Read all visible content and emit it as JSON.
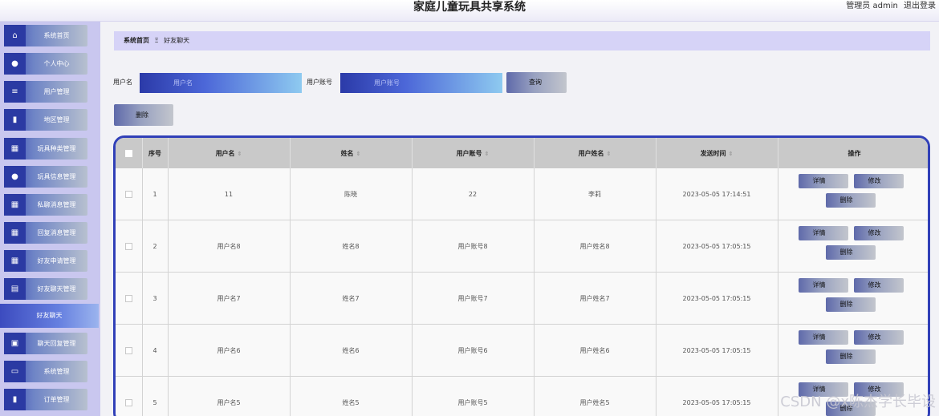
{
  "header": {
    "title": "家庭儿童玩具共享系统",
    "role": "管理员 admin",
    "logout": "退出登录"
  },
  "sidebar": {
    "items": [
      {
        "label": "系统首页",
        "icon": "home-icon",
        "glyph": "⌂"
      },
      {
        "label": "个人中心",
        "icon": "user-icon",
        "glyph": "●"
      },
      {
        "label": "用户管理",
        "icon": "list-icon",
        "glyph": "≡"
      },
      {
        "label": "地区管理",
        "icon": "bar-chart-icon",
        "glyph": "▮"
      },
      {
        "label": "玩具种类管理",
        "icon": "grid-icon",
        "glyph": "▦"
      },
      {
        "label": "玩具信息管理",
        "icon": "user-icon",
        "glyph": "●"
      },
      {
        "label": "私聊消息管理",
        "icon": "grid-icon",
        "glyph": "▦"
      },
      {
        "label": "回复消息管理",
        "icon": "grid-icon",
        "glyph": "▦"
      },
      {
        "label": "好友申请管理",
        "icon": "grid-icon",
        "glyph": "▦"
      },
      {
        "label": "好友聊天管理",
        "icon": "document-icon",
        "glyph": "▤"
      },
      {
        "label": "聊天回复管理",
        "icon": "clipboard-icon",
        "glyph": "▣"
      },
      {
        "label": "系统管理",
        "icon": "chat-icon",
        "glyph": "▭"
      },
      {
        "label": "订单管理",
        "icon": "chart-icon",
        "glyph": "▮"
      }
    ],
    "active_sub": "好友聊天"
  },
  "breadcrumb": {
    "home": "系统首页",
    "separator": "Ξ",
    "current": "好友聊天"
  },
  "search": {
    "username_label": "用户名",
    "username_placeholder": "用户名",
    "account_label": "用户账号",
    "account_placeholder": "用户账号",
    "query_button": "查询"
  },
  "actions": {
    "delete_button": "删除"
  },
  "table": {
    "headers": [
      "序号",
      "用户名",
      "姓名",
      "用户账号",
      "用户姓名",
      "发送时间",
      "操作"
    ],
    "rows": [
      {
        "no": "1",
        "username": "11",
        "name": "陈晓",
        "account": "22",
        "user_name": "李莉",
        "time": "2023-05-05 17:14:51"
      },
      {
        "no": "2",
        "username": "用户名8",
        "name": "姓名8",
        "account": "用户账号8",
        "user_name": "用户姓名8",
        "time": "2023-05-05 17:05:15"
      },
      {
        "no": "3",
        "username": "用户名7",
        "name": "姓名7",
        "account": "用户账号7",
        "user_name": "用户姓名7",
        "time": "2023-05-05 17:05:15"
      },
      {
        "no": "4",
        "username": "用户名6",
        "name": "姓名6",
        "account": "用户账号6",
        "user_name": "用户姓名6",
        "time": "2023-05-05 17:05:15"
      },
      {
        "no": "5",
        "username": "用户名5",
        "name": "姓名5",
        "account": "用户账号5",
        "user_name": "用户姓名5",
        "time": "2023-05-05 17:05:15"
      }
    ],
    "row_actions": {
      "detail": "详情",
      "edit": "修改",
      "delete": "删除"
    }
  },
  "watermark": "CSDN @x陈杰学长毕设"
}
